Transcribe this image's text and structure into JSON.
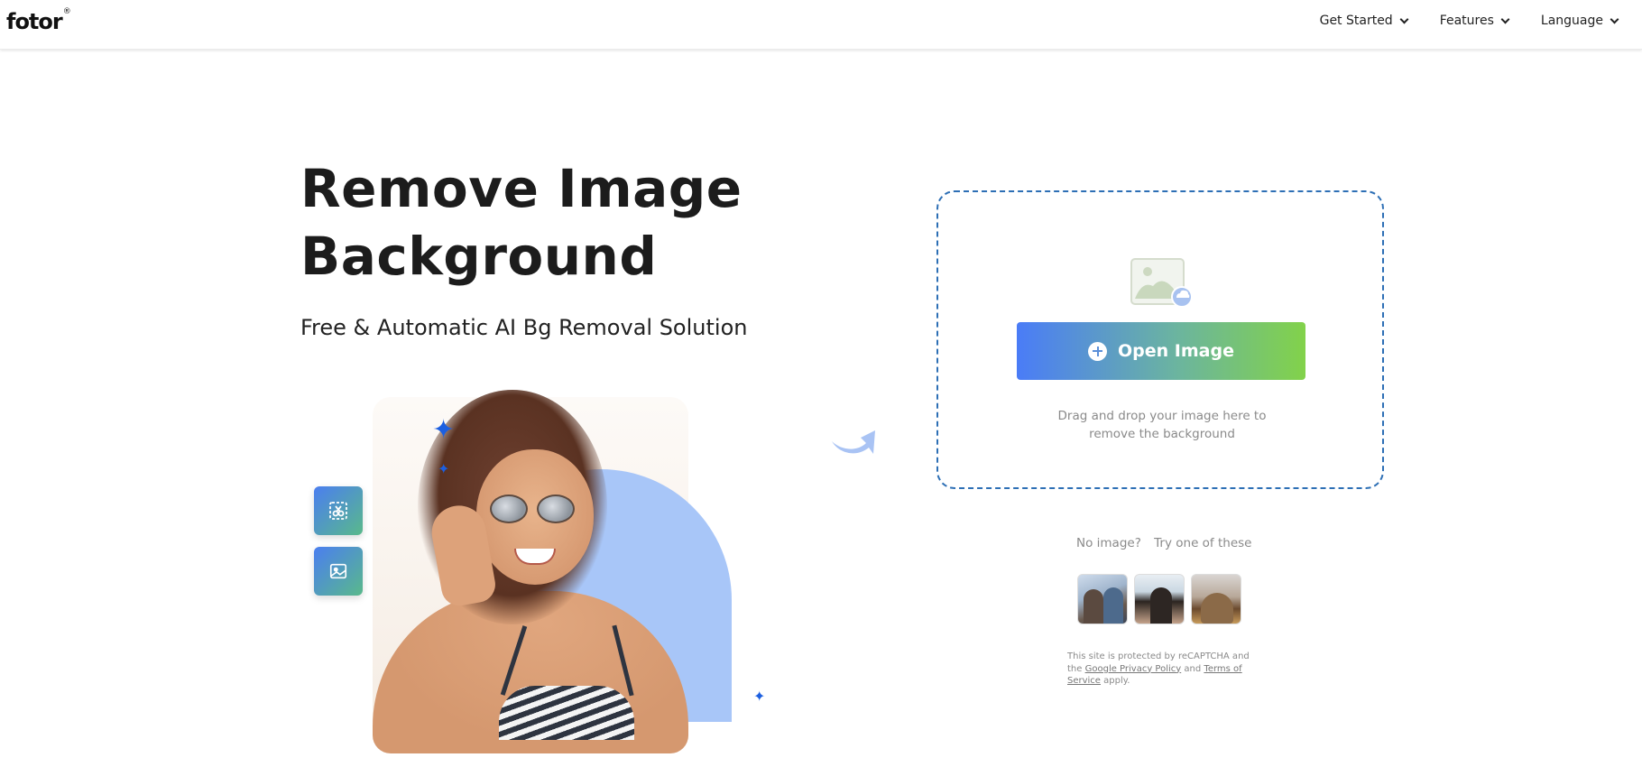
{
  "header": {
    "logo": "fotor",
    "logo_mark": "®",
    "nav": [
      {
        "label": "Get Started",
        "icon": "chevron-down-icon"
      },
      {
        "label": "Features",
        "icon": "chevron-down-icon"
      },
      {
        "label": "Language",
        "icon": "chevron-down-icon"
      }
    ]
  },
  "hero": {
    "title_line1": "Remove Image",
    "title_line2": "Background",
    "subtitle": "Free & Automatic AI Bg Removal Solution"
  },
  "upload": {
    "button_label": "Open Image",
    "drag_line1": "Drag and drop your image here to",
    "drag_line2": "remove the background"
  },
  "samples": {
    "no_image_label": "No image?",
    "try_label": "Try one of these",
    "items": [
      "sample-couple",
      "sample-woman-beach",
      "sample-cat"
    ]
  },
  "recaptcha": {
    "prefix": "This site is protected by reCAPTCHA and the",
    "privacy_link": "Google Privacy Policy",
    "and": "and",
    "terms_link": "Terms of Service",
    "suffix": "apply."
  },
  "colors": {
    "accent_blue": "#4a7cf7",
    "accent_green": "#82d24a",
    "dashed_border": "#2d6fb5",
    "sparkle": "#1c5fe0"
  }
}
